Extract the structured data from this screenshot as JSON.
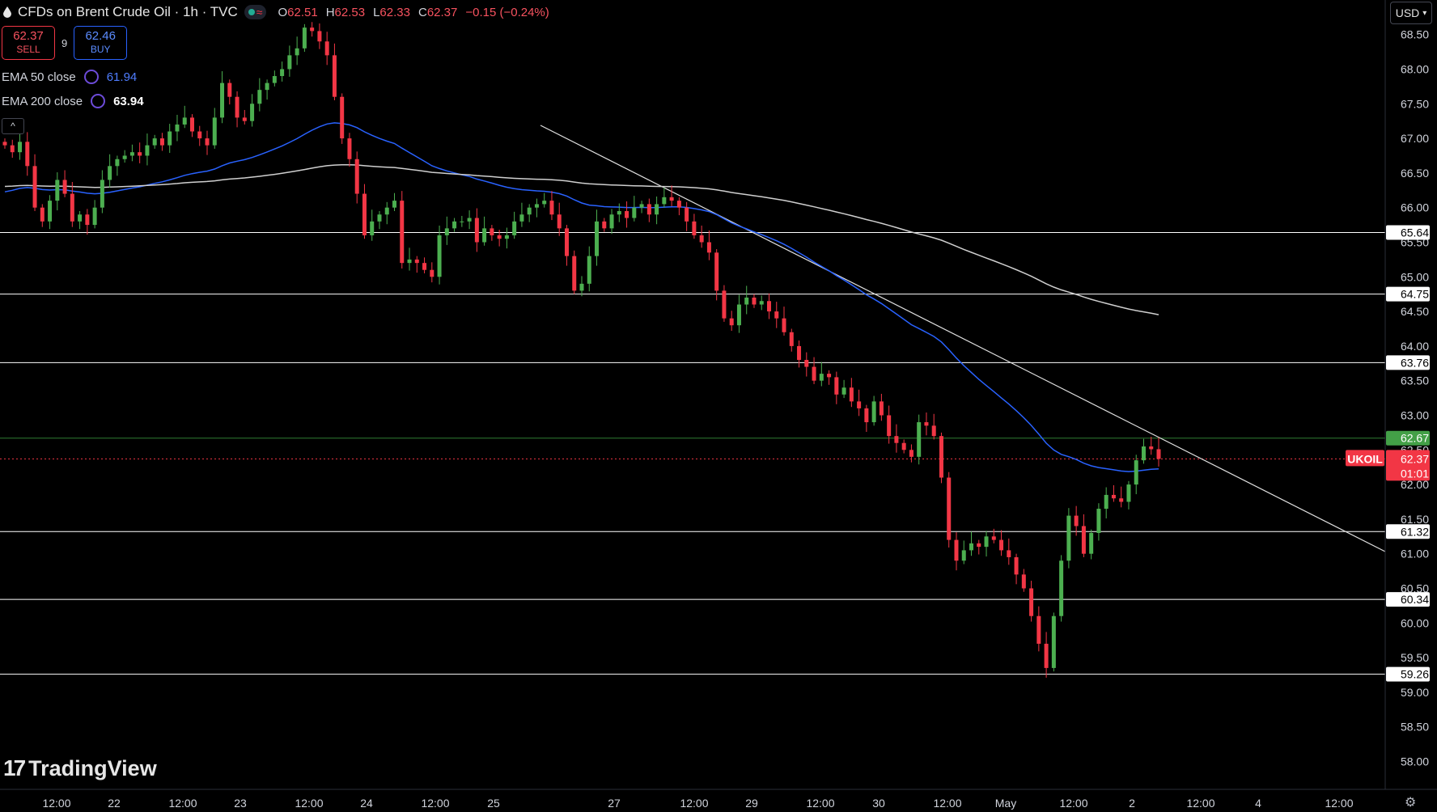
{
  "header": {
    "title": "CFDs on Brent Crude Oil · 1h · TVC",
    "ohlc": [
      {
        "k": "O",
        "v": "62.51"
      },
      {
        "k": "H",
        "v": "62.53"
      },
      {
        "k": "L",
        "v": "62.33"
      },
      {
        "k": "C",
        "v": "62.37"
      },
      {
        "k": "",
        "v": "−0.15 (−0.24%)"
      }
    ],
    "wave_glyph": "≈"
  },
  "trade": {
    "sell_price": "62.37",
    "sell_label": "SELL",
    "spread": "9",
    "buy_price": "62.46",
    "buy_label": "BUY"
  },
  "indicators": [
    {
      "label": "EMA 50 close",
      "value": "61.94",
      "color": "#2962ff"
    },
    {
      "label": "EMA 200 close",
      "value": "63.94",
      "color": "#ffffff"
    }
  ],
  "collapse_glyph": "^",
  "currency": "USD",
  "brand": "TradingView",
  "colors": {
    "up": "#4caf50",
    "down": "#f23645",
    "ema50": "#2962ff",
    "ema200": "#cfcfcf",
    "level": "#ffffff",
    "last": "#f23645"
  },
  "chart_data": {
    "type": "candlestick",
    "symbol": "UKOIL",
    "last_price": "62.37",
    "countdown": "01:01",
    "ylim": [
      57.5,
      68.8
    ],
    "y_ticks": [
      "58.00",
      "58.50",
      "59.00",
      "59.50",
      "60.00",
      "60.50",
      "61.00",
      "61.50",
      "62.00",
      "62.50",
      "63.00",
      "63.50",
      "64.00",
      "64.50",
      "65.00",
      "65.50",
      "66.00",
      "66.50",
      "67.00",
      "67.50",
      "68.00",
      "68.50"
    ],
    "x_ticks": [
      "12:00",
      "22",
      "12:00",
      "23",
      "12:00",
      "24",
      "12:00",
      "25",
      "27",
      "12:00",
      "29",
      "12:00",
      "30",
      "12:00",
      "May",
      "12:00",
      "2",
      "12:00",
      "4",
      "12:00"
    ],
    "levels": [
      "65.64",
      "64.75",
      "63.76",
      "61.32",
      "60.34",
      "59.26"
    ],
    "green_level": "62.67",
    "closes": [
      66.9,
      66.8,
      66.95,
      66.6,
      66.0,
      65.8,
      66.1,
      66.4,
      66.2,
      65.8,
      65.9,
      65.75,
      66.0,
      66.4,
      66.6,
      66.7,
      66.75,
      66.8,
      66.75,
      66.9,
      67.0,
      66.9,
      67.1,
      67.2,
      67.3,
      67.1,
      67.0,
      66.9,
      67.3,
      67.8,
      67.6,
      67.3,
      67.25,
      67.5,
      67.7,
      67.8,
      67.9,
      68.0,
      68.2,
      68.3,
      68.6,
      68.55,
      68.4,
      68.2,
      67.6,
      67.0,
      66.7,
      66.2,
      65.6,
      65.8,
      65.9,
      66.0,
      66.1,
      65.2,
      65.25,
      65.2,
      65.1,
      65.0,
      65.6,
      65.7,
      65.8,
      65.8,
      65.85,
      65.5,
      65.7,
      65.6,
      65.55,
      65.6,
      65.8,
      65.9,
      66.0,
      66.05,
      66.1,
      65.9,
      65.7,
      65.3,
      64.8,
      64.9,
      65.3,
      65.8,
      65.7,
      65.9,
      65.95,
      65.85,
      66.0,
      66.05,
      65.9,
      66.05,
      66.15,
      66.1,
      66.0,
      65.8,
      65.6,
      65.5,
      65.35,
      64.8,
      64.4,
      64.3,
      64.6,
      64.7,
      64.6,
      64.65,
      64.5,
      64.4,
      64.2,
      64.0,
      63.8,
      63.7,
      63.5,
      63.6,
      63.55,
      63.3,
      63.4,
      63.2,
      63.1,
      62.9,
      63.2,
      63.0,
      62.7,
      62.6,
      62.5,
      62.4,
      62.9,
      62.85,
      62.7,
      62.1,
      61.2,
      60.9,
      61.05,
      61.15,
      61.1,
      61.25,
      61.2,
      61.05,
      60.95,
      60.7,
      60.5,
      60.1,
      59.7,
      59.35,
      60.1,
      60.9,
      61.55,
      61.4,
      61.0,
      61.3,
      61.65,
      61.85,
      61.8,
      61.75,
      62.0,
      62.35,
      62.55,
      62.51,
      62.37
    ],
    "ema50_end": "61.94",
    "ema200_end": "63.94"
  }
}
